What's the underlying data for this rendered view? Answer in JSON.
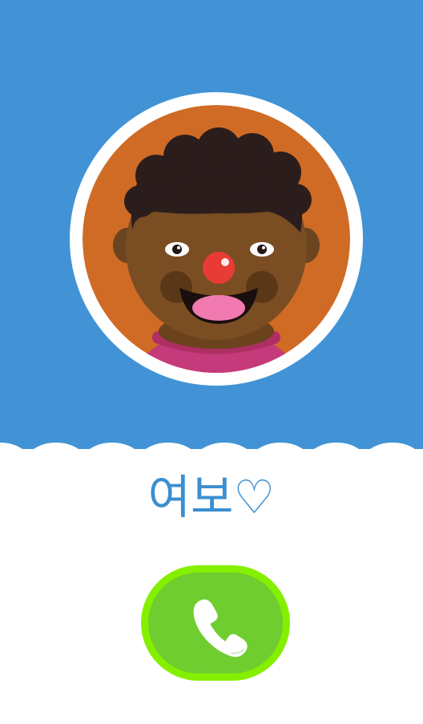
{
  "contact": {
    "name": "여보♡"
  },
  "call_button": {
    "icon": "phone-handset-icon"
  },
  "avatar": {
    "icon": "cartoon-child-avatar"
  },
  "colors": {
    "background_blue": "#4193d5",
    "name_blue": "#3a8fd1",
    "call_green": "#6fcd2f",
    "call_green_border": "#84f000",
    "avatar_orange": "#d06b25",
    "skin": "#7a4e22",
    "hair": "#2b1d1c",
    "nose": "#e83b36",
    "shirt": "#c53a7a"
  }
}
